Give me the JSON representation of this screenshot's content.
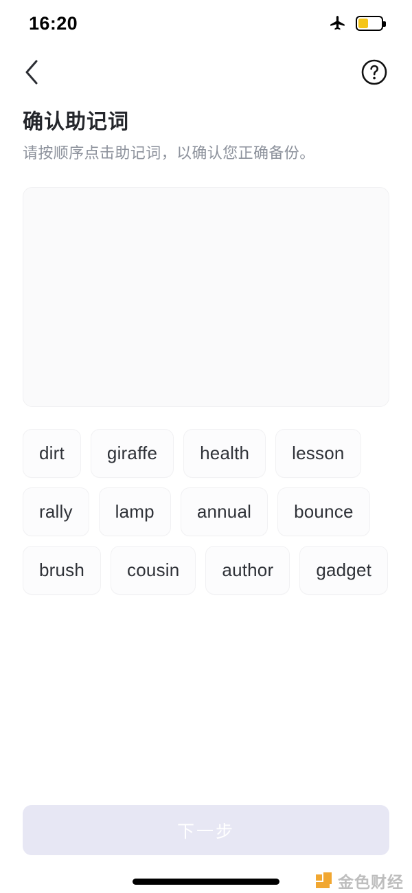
{
  "status_bar": {
    "time": "16:20",
    "airplane_icon": "airplane-mode-icon",
    "battery_icon": "battery-icon",
    "battery_fill_color": "#f5c518",
    "battery_level_percent": 40
  },
  "nav_bar": {
    "back_icon": "chevron-left-icon",
    "help_icon": "question-mark-circle-icon"
  },
  "heading": {
    "title": "确认助记词",
    "subtitle": "请按顺序点击助记词，以确认您正确备份。"
  },
  "answer_box": {
    "selected_words": [],
    "placeholder": ""
  },
  "word_pool": {
    "words": [
      "dirt",
      "giraffe",
      "health",
      "lesson",
      "rally",
      "lamp",
      "annual",
      "bounce",
      "brush",
      "cousin",
      "author",
      "gadget"
    ]
  },
  "footer": {
    "next_label": "下一步",
    "next_enabled": false,
    "next_background": "#e7e7f4",
    "next_text_color": "#ffffff"
  },
  "watermark": {
    "text": "金色财经",
    "logo_color": "#f0a020"
  }
}
